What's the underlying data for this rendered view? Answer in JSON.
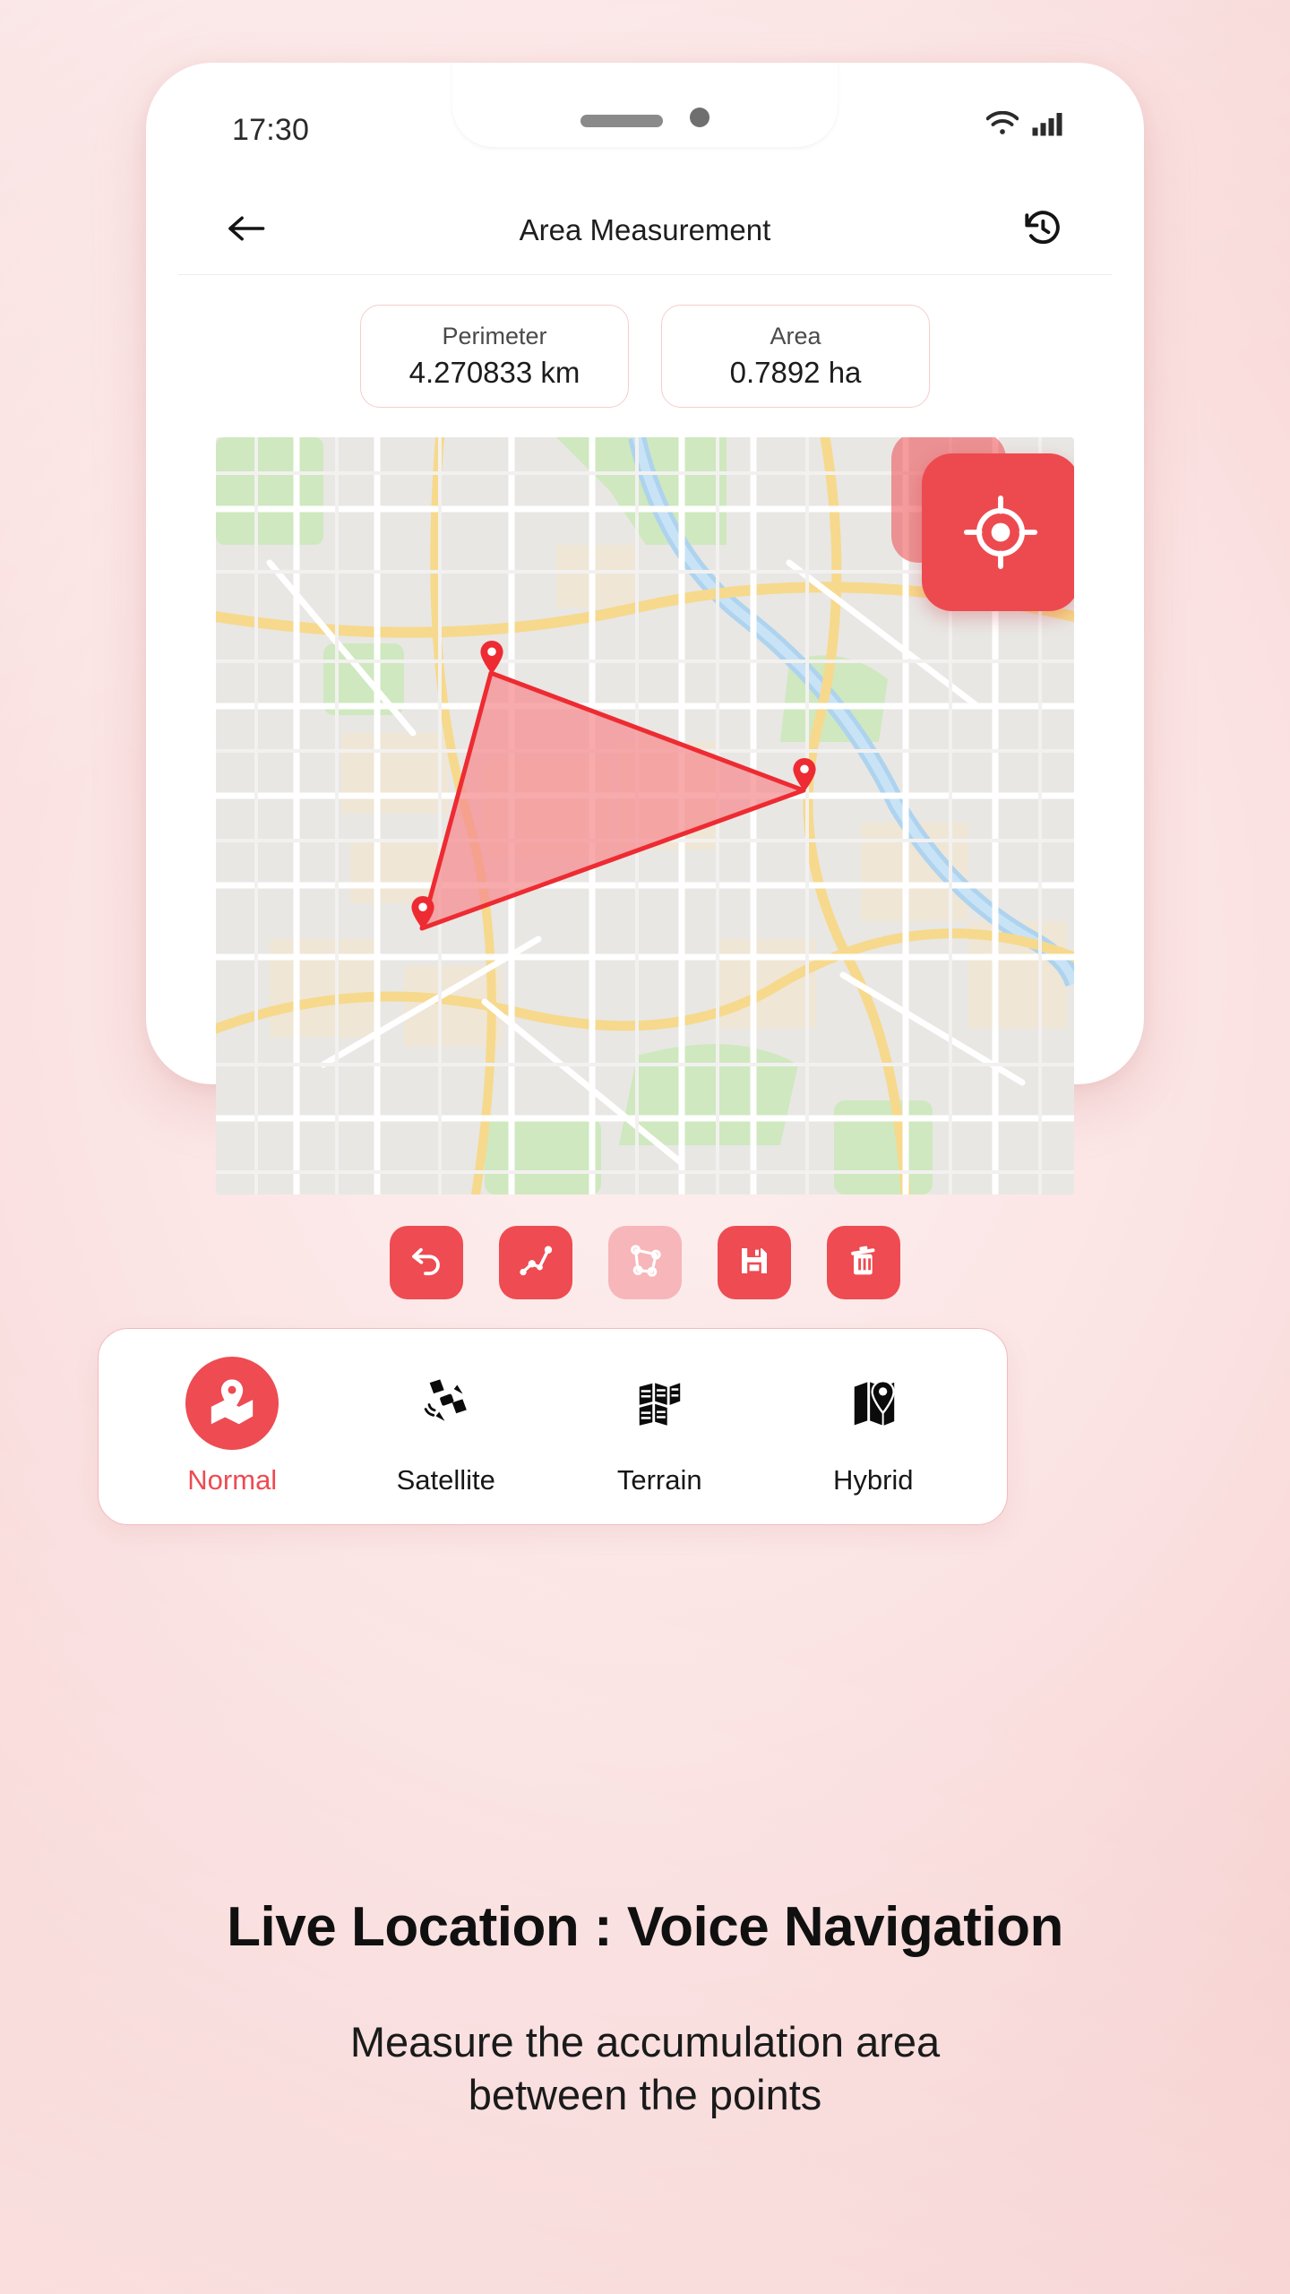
{
  "status_bar": {
    "time": "17:30",
    "wifi_icon": "wifi-icon",
    "signal_icon": "signal-bars-icon"
  },
  "app_bar": {
    "back_icon": "arrow-left-icon",
    "title": "Area Measurement",
    "history_icon": "history-clock-icon"
  },
  "stats": [
    {
      "label": "Perimeter",
      "value": "4.270833 km"
    },
    {
      "label": "Area",
      "value": "0.7892 ha"
    }
  ],
  "map": {
    "locate_button_icon": "crosshair-target-icon",
    "polygon_points": 3,
    "polygon_stroke": "#ee2b32",
    "polygon_fill": "#f58a8d",
    "marker_icon": "map-pin-icon"
  },
  "tools": [
    {
      "name": "undo",
      "icon": "undo-arrow-icon",
      "state": "enabled"
    },
    {
      "name": "path",
      "icon": "polyline-nodes-icon",
      "state": "enabled"
    },
    {
      "name": "polygon",
      "icon": "polygon-shape-icon",
      "state": "disabled"
    },
    {
      "name": "save",
      "icon": "floppy-save-icon",
      "state": "enabled"
    },
    {
      "name": "delete",
      "icon": "trash-bin-icon",
      "state": "enabled"
    }
  ],
  "map_types": [
    {
      "label": "Normal",
      "icon": "map-pin-fold-icon",
      "selected": true
    },
    {
      "label": "Satellite",
      "icon": "satellite-icon",
      "selected": false
    },
    {
      "label": "Terrain",
      "icon": "terrain-grid-icon",
      "selected": false
    },
    {
      "label": "Hybrid",
      "icon": "hybrid-map-pin-icon",
      "selected": false
    }
  ],
  "promo": {
    "headline": "Live Location : Voice Navigation",
    "subtitle_line1": "Measure the accumulation area",
    "subtitle_line2": "between the points"
  },
  "colors": {
    "accent": "#ee4b52",
    "accent_dim": "#f7b6b9",
    "background": "#f7d2d2"
  }
}
